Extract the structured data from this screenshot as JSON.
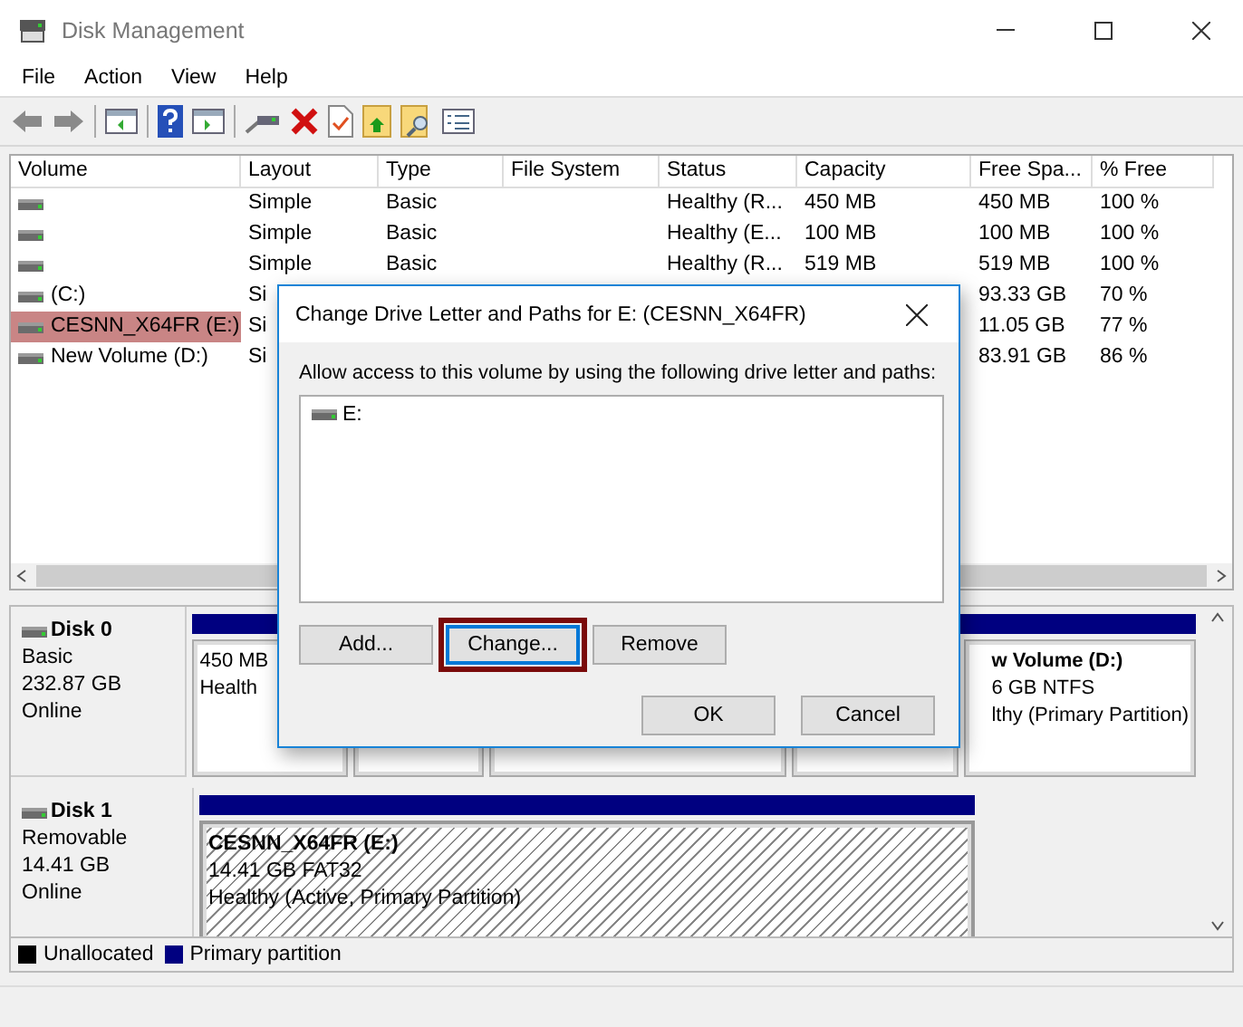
{
  "window": {
    "title": "Disk Management"
  },
  "menu": [
    "File",
    "Action",
    "View",
    "Help"
  ],
  "table": {
    "columns": [
      "Volume",
      "Layout",
      "Type",
      "File System",
      "Status",
      "Capacity",
      "Free Spa...",
      "% Free"
    ],
    "rows": [
      {
        "layout": "Simple",
        "type": "Basic",
        "status": "Healthy (R...",
        "capacity": "450 MB",
        "free_space": "450 MB",
        "percent_free": "100 %",
        "selected": false
      },
      {
        "layout": "Simple",
        "type": "Basic",
        "status": "Healthy (E...",
        "capacity": "100 MB",
        "free_space": "100 MB",
        "percent_free": "100 %",
        "selected": false
      },
      {
        "layout": "Simple",
        "type": "Basic",
        "status": "Healthy (R...",
        "capacity": "519 MB",
        "free_space": "519 MB",
        "percent_free": "100 %",
        "selected": false
      },
      {
        "volume": "(C:)",
        "layout": "Si",
        "free_space": "93.33 GB",
        "percent_free": "70 %",
        "selected": false
      },
      {
        "volume": "CESNN_X64FR (E:)",
        "layout": "Si",
        "free_space": "11.05 GB",
        "percent_free": "77 %",
        "selected": true
      },
      {
        "volume": "New Volume (D:)",
        "layout": "Si",
        "free_space": "83.91 GB",
        "percent_free": "86 %",
        "selected": false
      }
    ]
  },
  "disks": [
    {
      "name": "Disk 0",
      "type": "Basic",
      "size": "232.87 GB",
      "status": "Online",
      "partitions": [
        {
          "lines": [
            "450 MB",
            "Health"
          ],
          "selected": false
        },
        {
          "selected": false
        },
        {
          "selected": false
        },
        {
          "selected": false
        },
        {
          "name": "w Volume  (D:)",
          "lines": [
            "6 GB NTFS",
            "lthy (Primary Partition)"
          ],
          "selected": false
        }
      ]
    },
    {
      "name": "Disk 1",
      "type": "Removable",
      "size": "14.41 GB",
      "status": "Online",
      "partitions": [
        {
          "name": "CESNN_X64FR  (E:)",
          "lines": [
            "14.41 GB FAT32",
            "Healthy (Active, Primary Partition)"
          ],
          "selected": true
        }
      ]
    }
  ],
  "legend": [
    {
      "label": "Unallocated",
      "color": "#000000"
    },
    {
      "label": "Primary partition",
      "color": "#000080"
    }
  ],
  "dialog": {
    "title": "Change Drive Letter and Paths for E: (CESNN_X64FR)",
    "prompt": "Allow access to this volume by using the following drive letter and paths:",
    "paths": [
      "E:"
    ],
    "buttons": [
      {
        "label": "Add...",
        "focused": false
      },
      {
        "label": "Change...",
        "focused": true
      },
      {
        "label": "Remove",
        "focused": false
      }
    ],
    "footer_buttons": [
      "OK",
      "Cancel"
    ]
  }
}
